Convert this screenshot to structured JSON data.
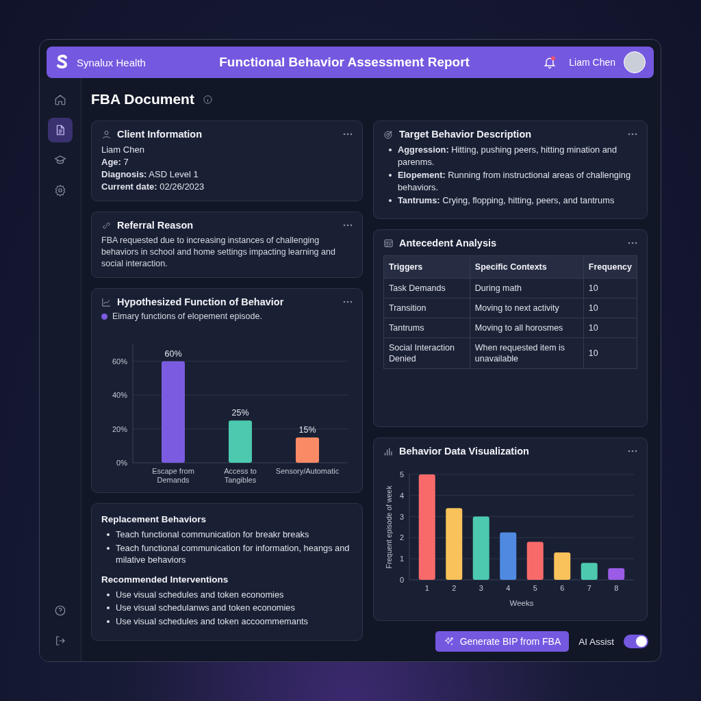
{
  "header": {
    "brand": "Synalux Health",
    "title": "Functional Behavior Assessment Report",
    "notifications": {
      "unread": true
    },
    "user": {
      "name": "Liam Chen"
    }
  },
  "sidebar": {
    "items": [
      {
        "kind": "home",
        "selected": false
      },
      {
        "kind": "document",
        "selected": true
      },
      {
        "kind": "education",
        "selected": false
      },
      {
        "kind": "settings",
        "selected": false
      }
    ],
    "bottom_items": [
      {
        "kind": "help"
      },
      {
        "kind": "logout"
      }
    ]
  },
  "page": {
    "title": "FBA Document"
  },
  "client_information": {
    "title": "Client Information",
    "lines": [
      "Liam Chen",
      "**Age:** 7",
      "**Diagnosis:** ASD Level 1",
      "**Current date:** 02/26/2023"
    ]
  },
  "referral_reason": {
    "title": "Referral Reason",
    "text": "FBA requested due to increasing instances of challenging behaviors in school and home settings impacting learning and social interaction."
  },
  "hypothesized_function": {
    "title": "Hypothesized Function of Behavior",
    "legend": {
      "label": "Eimary functions of elopement episode.",
      "color": "#7b5ce0"
    },
    "chart_data": {
      "type": "bar",
      "categories": [
        "Escape from Demands",
        "Access to Tangibles",
        "Sensory/Automatic"
      ],
      "series": [
        {
          "colors": [
            "#7b5ce0",
            "#4cc9ae",
            "#f98a66"
          ],
          "values": [
            60,
            25,
            15
          ]
        }
      ],
      "grid": true,
      "ylim": [
        0,
        70
      ],
      "yticks": [
        {
          "value": 0,
          "label": "0%"
        },
        {
          "value": 20,
          "label": "20%"
        },
        {
          "value": 40,
          "label": "40%"
        },
        {
          "value": 60,
          "label": "60%"
        }
      ],
      "value_labels": [
        "60%",
        "25%",
        "15%"
      ]
    }
  },
  "interventions": {
    "sections": [
      {
        "heading": "Replacement Behaviors",
        "items": [
          "Teach functional communication for breakr breaks",
          "Teach functional communication for information, heangs and milative behaviors"
        ]
      },
      {
        "heading": "Recommended Interventions",
        "items": [
          "Use visual schedules and token economies",
          "Use visual schedulanws and token economies",
          "Use visual schedules and token accoommemants"
        ]
      }
    ]
  },
  "target_behavior": {
    "title": "Target Behavior Description",
    "items": [
      "**Aggression:** Hitting, pushing peers, hitting mination and parenms.",
      "**Elopement:** Running from instructional areas of challenging behaviors.",
      "**Tantrums:** Crying, flopping, hitting, peers, and tantrums"
    ]
  },
  "antecedent_analysis": {
    "title": "Antecedent Analysis",
    "table": {
      "columns": [
        "Triggers",
        "Specific Contexts",
        "Frequency"
      ],
      "rows": [
        [
          "Task Demands",
          "During math",
          "10"
        ],
        [
          "Transition",
          "Moving to next activity",
          "10"
        ],
        [
          "Tantrums",
          "Moving to all horosmes",
          "10"
        ],
        [
          "Social Interaction Denied",
          "When requested item is unavailable",
          "10"
        ]
      ]
    }
  },
  "behavior_data": {
    "title": "Behavior Data Visualization",
    "chart_data": {
      "type": "bar",
      "xlabel": "Weeks",
      "ylabel": "Frequent episode of week",
      "categories": [
        "1",
        "2",
        "3",
        "4",
        "5",
        "6",
        "7",
        "8"
      ],
      "series": [
        {
          "colors": [
            "#f86a6a",
            "#f9c25a",
            "#4cc9ae",
            "#4f8ae0",
            "#f86a6a",
            "#f9c25a",
            "#4cc9ae",
            "#9a5ce6"
          ],
          "values": [
            5,
            3.4,
            3,
            2.25,
            1.8,
            1.3,
            0.8,
            0.55
          ]
        }
      ],
      "grid": true,
      "ylim": [
        0,
        5
      ],
      "yticks": [
        0,
        1,
        2,
        3,
        4,
        5
      ]
    }
  },
  "footer": {
    "generate_button": "Generate BIP from FBA",
    "ai_assist": {
      "label": "AI Assist",
      "on": true
    }
  }
}
